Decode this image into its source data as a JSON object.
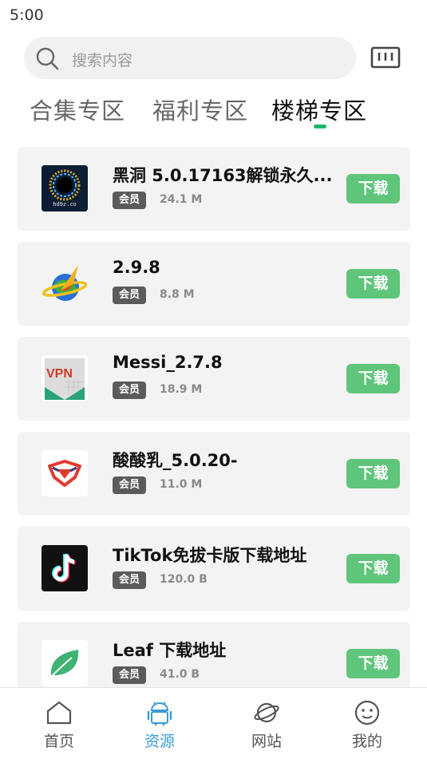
{
  "status": {
    "time": "5:00"
  },
  "search": {
    "placeholder": "搜索内容",
    "icon": "search-icon",
    "scan_icon": "scan-icon"
  },
  "tabs": [
    {
      "label": "合集专区",
      "active": false
    },
    {
      "label": "福利专区",
      "active": false
    },
    {
      "label": "楼梯专区",
      "active": true
    }
  ],
  "colors": {
    "accent": "#1fb36b",
    "download": "#5fc57a",
    "nav_active": "#3a9bd6",
    "badge": "#5b5b5b"
  },
  "apps": [
    {
      "name": "黑洞 5.0.17163解锁永久...",
      "badge": "会员",
      "size": "24.1 M",
      "button": "下载",
      "icon": "black-hole-app-icon",
      "icon_text": "hd9z.co"
    },
    {
      "name": " 2.9.8",
      "badge": "会员",
      "size": "8.8 M",
      "button": "下载",
      "icon": "globe-rocket-app-icon"
    },
    {
      "name": "Messi_2.7.8",
      "badge": "会员",
      "size": "18.9 M",
      "button": "下载",
      "icon": "vpn-shield-app-icon",
      "icon_text": "VPN"
    },
    {
      "name": "酸酸乳_5.0.20-",
      "badge": "会员",
      "size": "11.0 M",
      "button": "下载",
      "icon": "red-emblem-app-icon"
    },
    {
      "name": "TikTok免拔卡版下载地址",
      "badge": "会员",
      "size": "120.0 B",
      "button": "下载",
      "icon": "tiktok-app-icon"
    },
    {
      "name": "Leaf 下载地址",
      "badge": "会员",
      "size": "41.0 B",
      "button": "下载",
      "icon": "leaf-app-icon"
    }
  ],
  "nav": [
    {
      "label": "首页",
      "icon": "home-icon",
      "active": false
    },
    {
      "label": "资源",
      "icon": "android-icon",
      "active": true
    },
    {
      "label": "网站",
      "icon": "planet-icon",
      "active": false
    },
    {
      "label": "我的",
      "icon": "smiley-icon",
      "active": false
    }
  ]
}
